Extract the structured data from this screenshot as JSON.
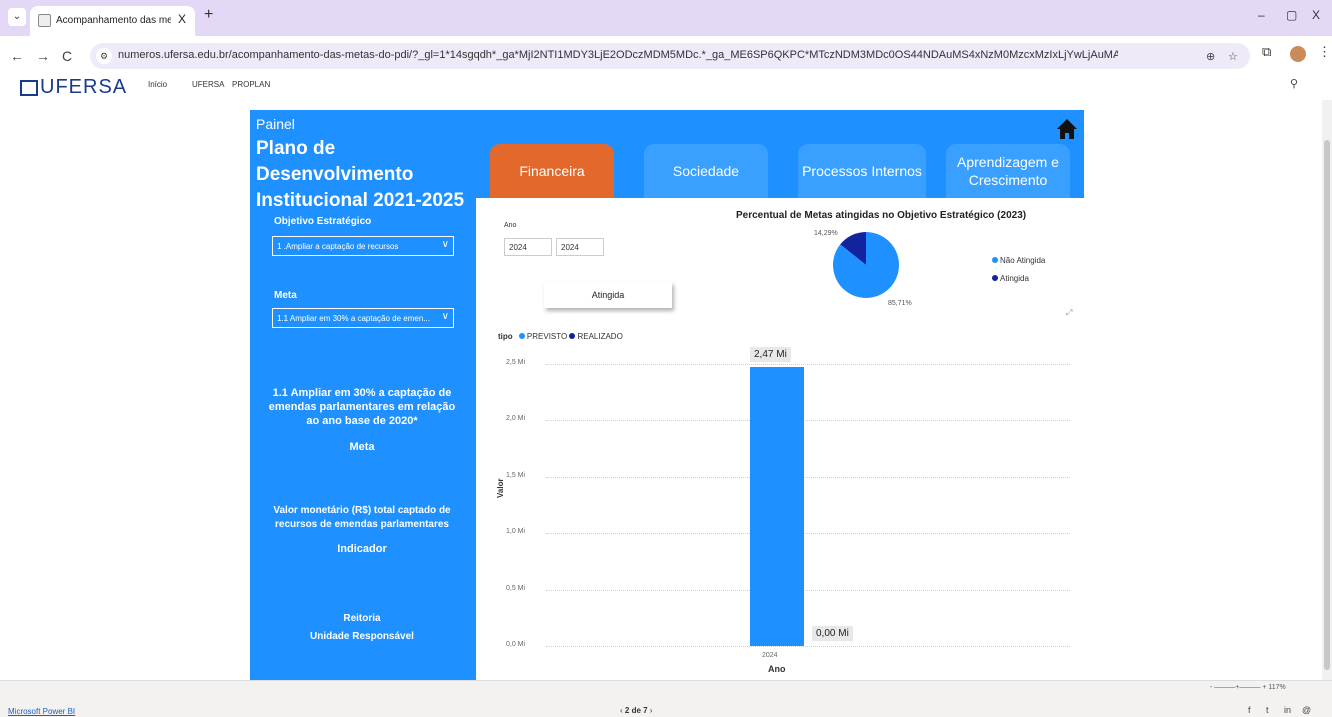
{
  "browser": {
    "tab_title": "Acompanhamento das metas d",
    "tab_close": "X",
    "new_tab": "+",
    "url": "numeros.ufersa.edu.br/acompanhamento-das-metas-do-pdi/?_gl=1*14sgqdh*_ga*MjI2NTI1MDY3LjE2ODczMDM5MDc.*_ga_ME6SP6QKPC*MTczNDM3MDc0OS44NDAuMS4xNzM0MzcxMzIxLjYwLjAuMA..",
    "back": "←",
    "forward": "→",
    "reload": "C",
    "minimize": "–",
    "restore": "▢",
    "close": "X"
  },
  "site": {
    "logo": "UFERSA",
    "nav": [
      "Início",
      "UFERSA",
      "PROPLAN"
    ]
  },
  "report": {
    "painel": "Painel",
    "title": "Plano de Desenvolvimento Institucional 2021-2025",
    "tabs": [
      "Financeira",
      "Sociedade",
      "Processos Internos",
      "Aprendizagem e Crescimento"
    ],
    "objetivo_label": "Objetivo Estratégico",
    "objetivo_value": "1 .Ampliar a captação de recursos",
    "meta_label": "Meta",
    "meta_value": "1.1 Ampliar em 30% a captação de emen...",
    "meta_text": "1.1 Ampliar em 30% a captação de emendas parlamentares em relação ao ano base de 2020*",
    "meta_caption": "Meta",
    "indicador_text": "Valor monetário (R$) total captado de recursos de emendas parlamentares",
    "indicador_caption": "Indicador",
    "unidade_text": "Reitoria",
    "unidade_caption": "Unidade Responsável",
    "ano_label": "Ano",
    "ano_from": "2024",
    "ano_to": "2024",
    "status_button": "Atingida",
    "tipo_label": "tipo",
    "tipo_previsto": "PREVISTO",
    "tipo_realizado": "REALIZADO"
  },
  "chart_data": [
    {
      "type": "pie",
      "title": "Percentual de Metas atingidas no Objetivo Estratégico (2023)",
      "labels": [
        "Não Atingida",
        "Atingida"
      ],
      "values": [
        85.71,
        14.29
      ],
      "data_labels": [
        "85,71%",
        "14,29%"
      ],
      "colors": [
        "#1e90ff",
        "#12239e"
      ],
      "legend": "right"
    },
    {
      "type": "bar",
      "categories": [
        "2024"
      ],
      "series": [
        {
          "name": "PREVISTO",
          "values": [
            2.47
          ],
          "color": "#1e90ff"
        },
        {
          "name": "REALIZADO",
          "values": [
            0.0
          ],
          "color": "#12239e"
        }
      ],
      "data_labels": [
        "2,47 Mi",
        "0,00 Mi"
      ],
      "xlabel": "Ano",
      "ylabel": "Valor",
      "yticks": [
        "0,0 Mi",
        "0,5 Mi",
        "1,0 Mi",
        "1,5 Mi",
        "2,0 Mi",
        "2,5 Mi"
      ],
      "ylim": [
        0,
        2.5
      ],
      "grid": true
    }
  ],
  "footer": {
    "powerbi": "Microsoft Power BI",
    "pager": "2 de 7",
    "zoom": "117%"
  }
}
